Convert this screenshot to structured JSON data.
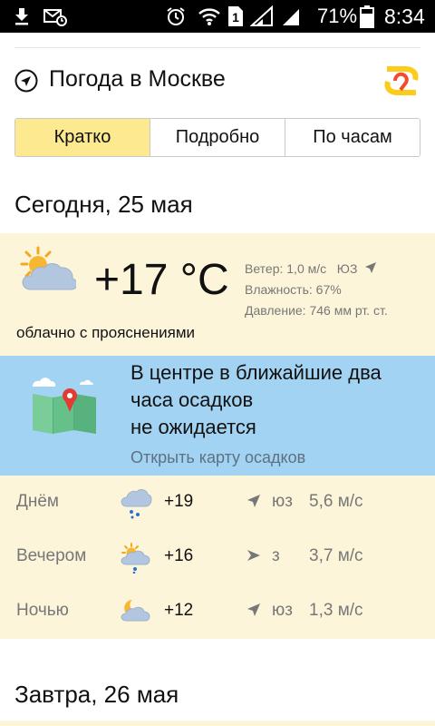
{
  "status_bar": {
    "battery_percent": "71%",
    "time": "8:34",
    "sim_number": "1",
    "icons": [
      "download-icon",
      "mail-icon",
      "alarm-icon",
      "wifi-icon",
      "sim-icon",
      "signal-icon",
      "battery-icon"
    ]
  },
  "header": {
    "title": "Погода в Москве",
    "icon": "location-arrow-icon",
    "logo": "yandex-weather-logo"
  },
  "tabs": [
    {
      "label": "Кратко",
      "active": true
    },
    {
      "label": "Подробно",
      "active": false
    },
    {
      "label": "По часам",
      "active": false
    }
  ],
  "today": {
    "date": "Сегодня, 25 мая",
    "temperature": "+17 °C",
    "condition": "облачно с прояснениями",
    "icon": "partly-cloudy-icon",
    "wind": "Ветер: 1,0 м/с   ЮЗ",
    "humidity": "Влажность: 67%",
    "pressure": "Давление: 746 мм рт. ст."
  },
  "precipitation": {
    "message_lines": [
      "В центре в ближайшие два",
      "часа осадков",
      "не ожидается"
    ],
    "link": "Открыть карту осадков",
    "icon": "rain-map-icon"
  },
  "periods": [
    {
      "label": "Днём",
      "temp": "+19",
      "dir": "юз",
      "speed": "5,6 м/с",
      "icon": "cloud-rain-icon"
    },
    {
      "label": "Вечером",
      "temp": "+16",
      "dir": "з",
      "speed": "3,7 м/с",
      "icon": "sun-cloud-rain-icon"
    },
    {
      "label": "Ночью",
      "temp": "+12",
      "dir": "юз",
      "speed": "1,3 м/с",
      "icon": "moon-cloud-icon"
    }
  ],
  "tomorrow": {
    "date": "Завтра, 26 мая"
  },
  "colors": {
    "active_tab": "#fde98f",
    "card_bg": "#fdf5d9",
    "rain_bg": "#a2d3f2",
    "logo_yellow": "#fccc1a",
    "logo_red": "#f24b2e"
  }
}
